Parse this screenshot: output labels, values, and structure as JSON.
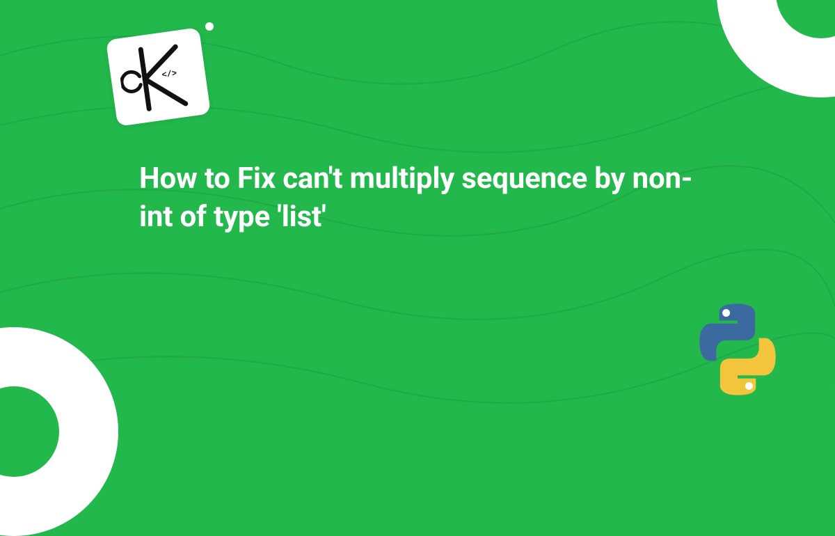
{
  "title": "How to Fix can't multiply sequence by non-int of type 'list'",
  "logo_letter": "K",
  "icons": {
    "logo": "k-code-logo",
    "python": "python-logo"
  },
  "colors": {
    "background": "#22b84c",
    "accent_white": "#ffffff",
    "python_blue": "#3c6aa0",
    "python_yellow": "#f2c53d"
  }
}
